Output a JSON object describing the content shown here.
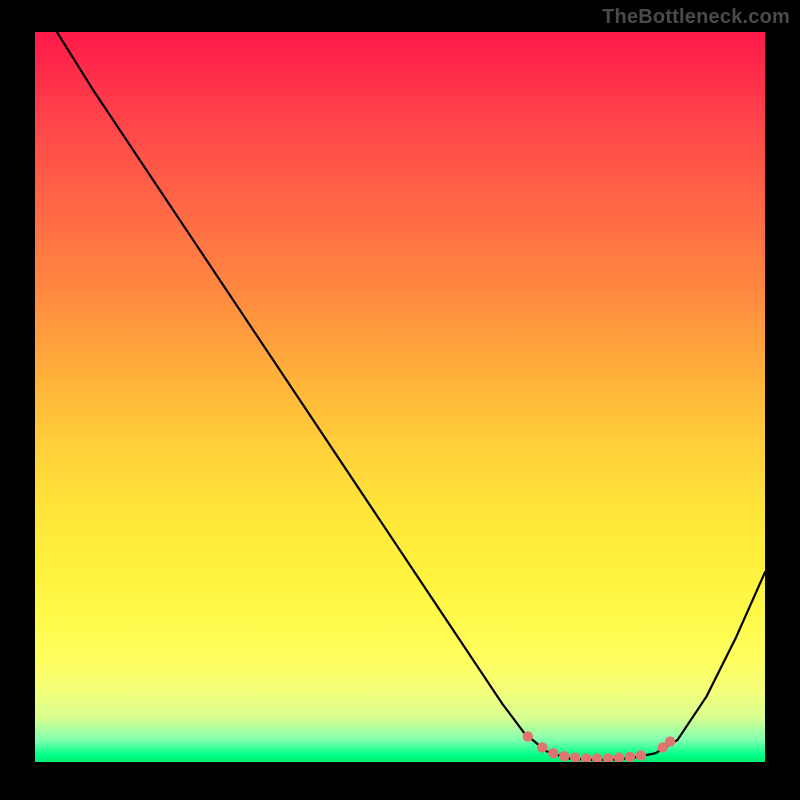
{
  "watermark": "TheBottleneck.com",
  "colors": {
    "curve": "#000000",
    "marker": "#e2746f",
    "plot_bg_top": "#ff1a4a",
    "plot_bg_bottom": "#00f070"
  },
  "chart_data": {
    "type": "line",
    "title": "",
    "xlabel": "",
    "ylabel": "",
    "x_range": [
      0,
      100
    ],
    "y_range_percent_mismatch": [
      0,
      100
    ],
    "note": "Bottleneck heat curve. Y visually encodes mismatch % (100 at top, 0 at bottom). Minimum near x ≈ 72–85.",
    "curve_points": [
      {
        "x": 3,
        "y": 100
      },
      {
        "x": 8,
        "y": 92
      },
      {
        "x": 14,
        "y": 83
      },
      {
        "x": 22,
        "y": 71
      },
      {
        "x": 30,
        "y": 59
      },
      {
        "x": 38,
        "y": 47
      },
      {
        "x": 46,
        "y": 35
      },
      {
        "x": 54,
        "y": 23
      },
      {
        "x": 60,
        "y": 14
      },
      {
        "x": 64,
        "y": 8
      },
      {
        "x": 67,
        "y": 4
      },
      {
        "x": 70,
        "y": 1.5
      },
      {
        "x": 73,
        "y": 0.5
      },
      {
        "x": 76,
        "y": 0.3
      },
      {
        "x": 79,
        "y": 0.3
      },
      {
        "x": 82,
        "y": 0.6
      },
      {
        "x": 85,
        "y": 1.2
      },
      {
        "x": 88,
        "y": 3
      },
      {
        "x": 92,
        "y": 9
      },
      {
        "x": 96,
        "y": 17
      },
      {
        "x": 100,
        "y": 26
      }
    ],
    "optimal_markers": [
      {
        "x": 67.5,
        "y": 3.5
      },
      {
        "x": 69.5,
        "y": 2.0
      },
      {
        "x": 71.0,
        "y": 1.2
      },
      {
        "x": 72.5,
        "y": 0.8
      },
      {
        "x": 74.0,
        "y": 0.6
      },
      {
        "x": 75.5,
        "y": 0.5
      },
      {
        "x": 77.0,
        "y": 0.5
      },
      {
        "x": 78.5,
        "y": 0.5
      },
      {
        "x": 80.0,
        "y": 0.6
      },
      {
        "x": 81.5,
        "y": 0.7
      },
      {
        "x": 83.0,
        "y": 0.9
      },
      {
        "x": 86.0,
        "y": 2.0
      },
      {
        "x": 87.0,
        "y": 2.8
      }
    ]
  }
}
